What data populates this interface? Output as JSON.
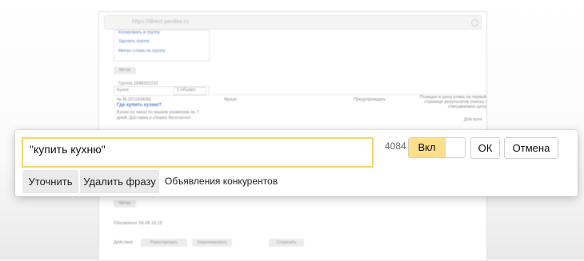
{
  "background": {
    "url_placeholder": "https://direct.yandex.ru",
    "menu_items": [
      "Копировать в группу",
      "Удалить группу",
      "Минус-слова на группу"
    ],
    "tags_label": "Метки",
    "group_label": "Группа 1848332232",
    "group_name": "Кухня",
    "ads_count_pill": "1 объявл.",
    "ad_number": "№ М-22114343Ш",
    "ad_title": "Где купить кухню?",
    "ad_text": "Кухни на заказ по вашим размерам за 7 дней. Доставка и сборка бесплатно!",
    "col_phrase": "Фраза",
    "col_forecast": "Предупреждать",
    "col_position": "Позиция и цена клика на первой странице результатов поиска / списываемая цена",
    "col_all": "Для всех",
    "tags_label_2": "Метки",
    "updated": "Обновлено: 05.08 15:15",
    "actions_label": "Действия",
    "edit_button": "Редактировать",
    "archive_button": "Заархивировать",
    "save_button": "Сохранить"
  },
  "popup": {
    "phrase_value": "\"купить кухню\"",
    "count": "4084",
    "toggle_label": "Вкл",
    "ok_label": "ОК",
    "cancel_label": "Отмена",
    "refine_label": "Уточнить",
    "delete_label": "Удалить фразу",
    "competitors_label": "Объявления конкурентов"
  }
}
